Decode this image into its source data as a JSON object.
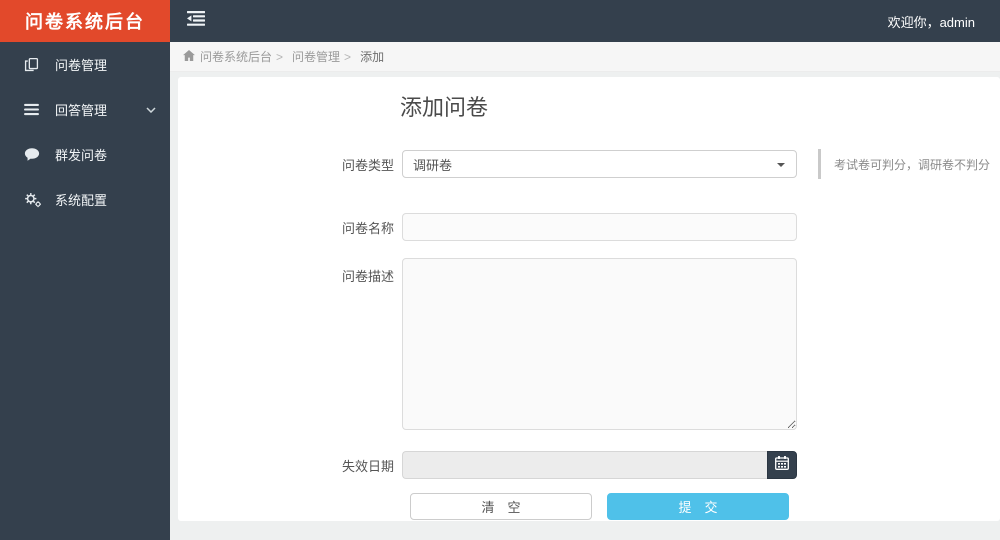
{
  "brand": {
    "title": "问卷系统后台"
  },
  "topbar": {
    "toggle_icon": "sidebar-toggle-icon",
    "welcome": "欢迎你，admin"
  },
  "sidebar": {
    "items": [
      {
        "label": "问卷管理",
        "icon": "copy-icon"
      },
      {
        "label": "回答管理",
        "icon": "list-icon",
        "chevron": "chevron-down-icon"
      },
      {
        "label": "群发问卷",
        "icon": "comment-icon"
      },
      {
        "label": "系统配置",
        "icon": "cogs-icon"
      }
    ]
  },
  "breadcrumb": {
    "home_icon": "home-icon",
    "home": "问卷系统后台",
    "separator": ">",
    "items": [
      "问卷管理",
      "添加"
    ]
  },
  "page": {
    "title": "添加问卷"
  },
  "form": {
    "type": {
      "label": "问卷类型",
      "value": "调研卷",
      "hint": "考试卷可判分，调研卷不判分"
    },
    "name": {
      "label": "问卷名称",
      "value": ""
    },
    "desc": {
      "label": "问卷描述",
      "value": ""
    },
    "date": {
      "label": "失效日期",
      "value": "",
      "icon": "calendar-icon"
    },
    "actions": {
      "clear": "清　空",
      "submit": "提　交"
    }
  },
  "colors": {
    "brand": "#e2492b",
    "chrome": "#34404d",
    "accent": "#4fc1e9"
  }
}
